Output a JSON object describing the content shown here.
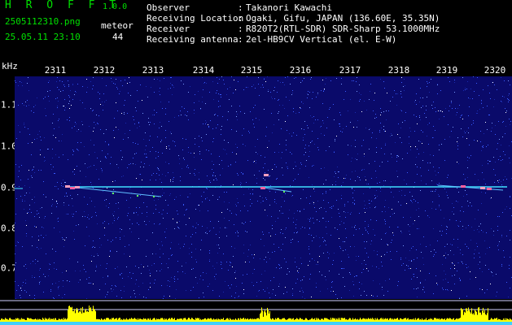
{
  "header": {
    "title": "H R O F F T",
    "version": "1.0.0",
    "file_name": "2505112310.png",
    "date_time": "25.05.11 23:10",
    "meteor_label": "meteor",
    "meteor_count": "44"
  },
  "info": [
    {
      "label": "Observer",
      "sep": ":",
      "value": "Takanori Kawachi"
    },
    {
      "label": "Receiving Location",
      "sep": ":",
      "value": "Ogaki, Gifu, JAPAN (136.60E, 35.35N)"
    },
    {
      "label": "Receiver",
      "sep": ":",
      "value": "R820T2(RTL-SDR) SDR-Sharp 53.1000MHz"
    },
    {
      "label": "Receiving antenna",
      "sep": ":",
      "value": "2el-HB9CV Vertical (el. E-W)"
    }
  ],
  "axes": {
    "y_unit": "kHz",
    "x_ticks": [
      "2311",
      "2312",
      "2313",
      "2314",
      "2315",
      "2316",
      "2317",
      "2318",
      "2319",
      "2320"
    ],
    "y_ticks": [
      "1.1",
      "1.0",
      "0.9",
      "0.8",
      "0.7",
      "0.6"
    ]
  },
  "colors": {
    "header_green": "#00e000",
    "background_blue": "#0a0a6a",
    "trace_cyan": "#40e0ff",
    "activity_yellow": "#ffff00"
  }
}
